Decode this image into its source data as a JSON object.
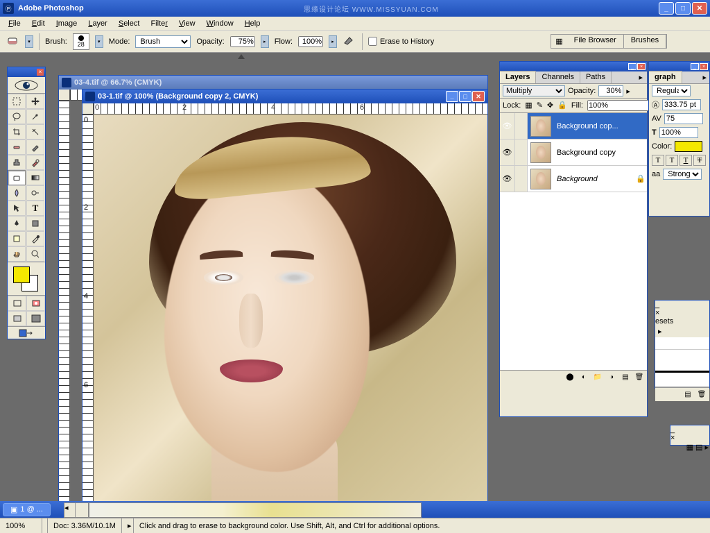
{
  "app": {
    "title": "Adobe Photoshop",
    "watermark": "思缘设计论坛 WWW.MISSYUAN.COM"
  },
  "menu": {
    "file": "File",
    "edit": "Edit",
    "image": "Image",
    "layer": "Layer",
    "select": "Select",
    "filter": "Filter",
    "view": "View",
    "window": "Window",
    "help": "Help"
  },
  "options": {
    "brush_label": "Brush:",
    "brush_size": "28",
    "mode_label": "Mode:",
    "mode_value": "Brush",
    "opacity_label": "Opacity:",
    "opacity_value": "75%",
    "flow_label": "Flow:",
    "flow_value": "100%",
    "erase_label": "Erase to History",
    "tab_file_browser": "File Browser",
    "tab_brushes": "Brushes"
  },
  "doc_back": {
    "title": "03-4.tif @ 66.7% (CMYK)"
  },
  "doc_front": {
    "title": "03-1.tif @ 100% (Background copy 2, CMYK)"
  },
  "layers_panel": {
    "tabs": {
      "layers": "Layers",
      "channels": "Channels",
      "paths": "Paths"
    },
    "blend_mode": "Multiply",
    "opacity_label": "Opacity:",
    "opacity": "30%",
    "lock_label": "Lock:",
    "fill_label": "Fill:",
    "fill": "100%",
    "layers": [
      {
        "name": "Background cop...",
        "selected": true,
        "locked": false,
        "italic": false
      },
      {
        "name": "Background copy",
        "selected": false,
        "locked": false,
        "italic": false
      },
      {
        "name": "Background",
        "selected": false,
        "locked": true,
        "italic": true
      }
    ]
  },
  "char_panel": {
    "tab": "graph",
    "font_style": "Regular",
    "size": "333.75 pt",
    "tracking": "75",
    "scale": "100%",
    "color_label": "Color:",
    "aa_label": "aa",
    "aa_value": "Strong"
  },
  "presets_panel": {
    "tab": "esets"
  },
  "taskbar": {
    "task1": "1 @ ..."
  },
  "status": {
    "zoom": "100%",
    "doc_info": "Doc: 3.36M/10.1M",
    "hint": "Click and drag to erase to background color.  Use Shift, Alt, and Ctrl for additional options."
  },
  "colors": {
    "foreground": "#f4e800",
    "background": "#ffffff"
  }
}
